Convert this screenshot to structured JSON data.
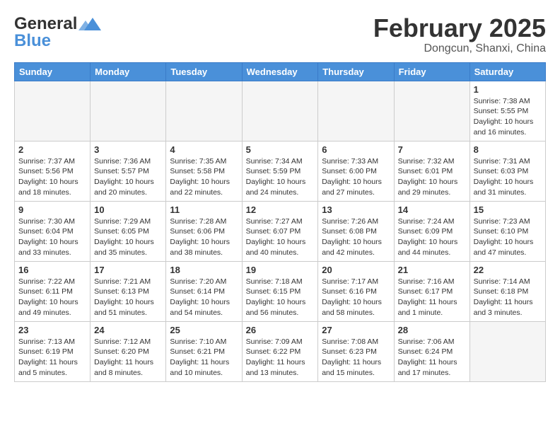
{
  "header": {
    "logo_general": "General",
    "logo_blue": "Blue",
    "title": "February 2025",
    "location": "Dongcun, Shanxi, China"
  },
  "days_of_week": [
    "Sunday",
    "Monday",
    "Tuesday",
    "Wednesday",
    "Thursday",
    "Friday",
    "Saturday"
  ],
  "weeks": [
    [
      {
        "day": "",
        "info": ""
      },
      {
        "day": "",
        "info": ""
      },
      {
        "day": "",
        "info": ""
      },
      {
        "day": "",
        "info": ""
      },
      {
        "day": "",
        "info": ""
      },
      {
        "day": "",
        "info": ""
      },
      {
        "day": "1",
        "info": "Sunrise: 7:38 AM\nSunset: 5:55 PM\nDaylight: 10 hours and 16 minutes."
      }
    ],
    [
      {
        "day": "2",
        "info": "Sunrise: 7:37 AM\nSunset: 5:56 PM\nDaylight: 10 hours and 18 minutes."
      },
      {
        "day": "3",
        "info": "Sunrise: 7:36 AM\nSunset: 5:57 PM\nDaylight: 10 hours and 20 minutes."
      },
      {
        "day": "4",
        "info": "Sunrise: 7:35 AM\nSunset: 5:58 PM\nDaylight: 10 hours and 22 minutes."
      },
      {
        "day": "5",
        "info": "Sunrise: 7:34 AM\nSunset: 5:59 PM\nDaylight: 10 hours and 24 minutes."
      },
      {
        "day": "6",
        "info": "Sunrise: 7:33 AM\nSunset: 6:00 PM\nDaylight: 10 hours and 27 minutes."
      },
      {
        "day": "7",
        "info": "Sunrise: 7:32 AM\nSunset: 6:01 PM\nDaylight: 10 hours and 29 minutes."
      },
      {
        "day": "8",
        "info": "Sunrise: 7:31 AM\nSunset: 6:03 PM\nDaylight: 10 hours and 31 minutes."
      }
    ],
    [
      {
        "day": "9",
        "info": "Sunrise: 7:30 AM\nSunset: 6:04 PM\nDaylight: 10 hours and 33 minutes."
      },
      {
        "day": "10",
        "info": "Sunrise: 7:29 AM\nSunset: 6:05 PM\nDaylight: 10 hours and 35 minutes."
      },
      {
        "day": "11",
        "info": "Sunrise: 7:28 AM\nSunset: 6:06 PM\nDaylight: 10 hours and 38 minutes."
      },
      {
        "day": "12",
        "info": "Sunrise: 7:27 AM\nSunset: 6:07 PM\nDaylight: 10 hours and 40 minutes."
      },
      {
        "day": "13",
        "info": "Sunrise: 7:26 AM\nSunset: 6:08 PM\nDaylight: 10 hours and 42 minutes."
      },
      {
        "day": "14",
        "info": "Sunrise: 7:24 AM\nSunset: 6:09 PM\nDaylight: 10 hours and 44 minutes."
      },
      {
        "day": "15",
        "info": "Sunrise: 7:23 AM\nSunset: 6:10 PM\nDaylight: 10 hours and 47 minutes."
      }
    ],
    [
      {
        "day": "16",
        "info": "Sunrise: 7:22 AM\nSunset: 6:11 PM\nDaylight: 10 hours and 49 minutes."
      },
      {
        "day": "17",
        "info": "Sunrise: 7:21 AM\nSunset: 6:13 PM\nDaylight: 10 hours and 51 minutes."
      },
      {
        "day": "18",
        "info": "Sunrise: 7:20 AM\nSunset: 6:14 PM\nDaylight: 10 hours and 54 minutes."
      },
      {
        "day": "19",
        "info": "Sunrise: 7:18 AM\nSunset: 6:15 PM\nDaylight: 10 hours and 56 minutes."
      },
      {
        "day": "20",
        "info": "Sunrise: 7:17 AM\nSunset: 6:16 PM\nDaylight: 10 hours and 58 minutes."
      },
      {
        "day": "21",
        "info": "Sunrise: 7:16 AM\nSunset: 6:17 PM\nDaylight: 11 hours and 1 minute."
      },
      {
        "day": "22",
        "info": "Sunrise: 7:14 AM\nSunset: 6:18 PM\nDaylight: 11 hours and 3 minutes."
      }
    ],
    [
      {
        "day": "23",
        "info": "Sunrise: 7:13 AM\nSunset: 6:19 PM\nDaylight: 11 hours and 5 minutes."
      },
      {
        "day": "24",
        "info": "Sunrise: 7:12 AM\nSunset: 6:20 PM\nDaylight: 11 hours and 8 minutes."
      },
      {
        "day": "25",
        "info": "Sunrise: 7:10 AM\nSunset: 6:21 PM\nDaylight: 11 hours and 10 minutes."
      },
      {
        "day": "26",
        "info": "Sunrise: 7:09 AM\nSunset: 6:22 PM\nDaylight: 11 hours and 13 minutes."
      },
      {
        "day": "27",
        "info": "Sunrise: 7:08 AM\nSunset: 6:23 PM\nDaylight: 11 hours and 15 minutes."
      },
      {
        "day": "28",
        "info": "Sunrise: 7:06 AM\nSunset: 6:24 PM\nDaylight: 11 hours and 17 minutes."
      },
      {
        "day": "",
        "info": ""
      }
    ]
  ]
}
